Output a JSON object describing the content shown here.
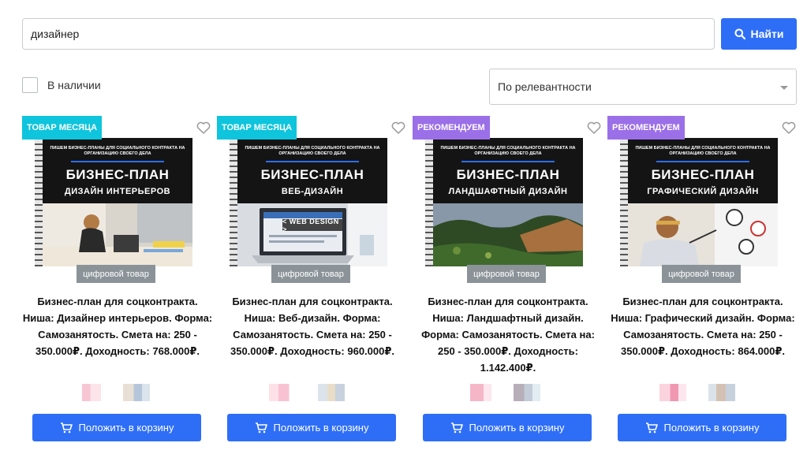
{
  "search": {
    "value": "дизайнер",
    "button_label": "Найти",
    "button_icon": "search-icon"
  },
  "filters": {
    "in_stock_label": "В наличии",
    "in_stock_checked": false,
    "sort_selected": "По релевантности"
  },
  "colors": {
    "accent": "#2e6ef7",
    "badge_month": "#0fc4dd",
    "badge_recommend": "#9b6fe8",
    "digital_tag": "#8b9399"
  },
  "products": [
    {
      "badge": "ТОВАР МЕСЯЦА",
      "badge_type": "month",
      "cover_sub": "ПИШЕМ БИЗНЕС-ПЛАНЫ ДЛЯ СОЦИАЛЬНОГО КОНТРАКТА НА ОРГАНИЗАЦИЮ СВОЕГО ДЕЛА",
      "cover_title": "БИЗНЕС-ПЛАН",
      "cover_niche": "ДИЗАЙН ИНТЕРЬЕРОВ",
      "digital_tag": "цифровой товар",
      "title": "Бизнес-план для соцконтракта. Ниша: Дизайнер интерьеров. Форма: Самозанятость. Смета на: 250 - 350.000₽. Доходность: 768.000₽.",
      "cart_label": "Положить в корзину"
    },
    {
      "badge": "ТОВАР МЕСЯЦА",
      "badge_type": "month",
      "cover_sub": "ПИШЕМ БИЗНЕС-ПЛАНЫ ДЛЯ СОЦИАЛЬНОГО КОНТРАКТА НА ОРГАНИЗАЦИЮ СВОЕГО ДЕЛА",
      "cover_title": "БИЗНЕС-ПЛАН",
      "cover_niche": "ВЕБ-ДИЗАЙН",
      "cover_photo_text": "< WEB DESIGN >",
      "digital_tag": "цифровой товар",
      "title": "Бизнес-план для соцконтракта. Ниша: Веб-дизайн. Форма: Самозанятость. Смета на: 250 - 350.000₽. Доходность: 960.000₽.",
      "cart_label": "Положить в корзину"
    },
    {
      "badge": "РЕКОМЕНДУЕМ",
      "badge_type": "recommend",
      "cover_sub": "ПИШЕМ БИЗНЕС-ПЛАНЫ ДЛЯ СОЦИАЛЬНОГО КОНТРАКТА НА ОРГАНИЗАЦИЮ СВОЕГО ДЕЛА",
      "cover_title": "БИЗНЕС-ПЛАН",
      "cover_niche": "ЛАНДШАФТНЫЙ ДИЗАЙН",
      "digital_tag": "цифровой товар",
      "title": "Бизнес-план для соцконтракта. Ниша: Ландшафтный дизайн. Форма: Самозанятость. Смета на: 250 - 350.000₽. Доходность: 1.142.400₽.",
      "cart_label": "Положить в корзину"
    },
    {
      "badge": "РЕКОМЕНДУЕМ",
      "badge_type": "recommend",
      "cover_sub": "ПИШЕМ БИЗНЕС-ПЛАНЫ ДЛЯ СОЦИАЛЬНОГО КОНТРАКТА НА ОРГАНИЗАЦИЮ СВОЕГО ДЕЛА",
      "cover_title": "БИЗНЕС-ПЛАН",
      "cover_niche": "ГРАФИЧЕСКИЙ ДИЗАЙН",
      "digital_tag": "цифровой товар",
      "title": "Бизнес-план для соцконтракта. Ниша: Графический дизайн. Форма: Самозанятость. Смета на: 250 - 350.000₽. Доходность: 864.000₽.",
      "cart_label": "Положить в корзину"
    }
  ]
}
